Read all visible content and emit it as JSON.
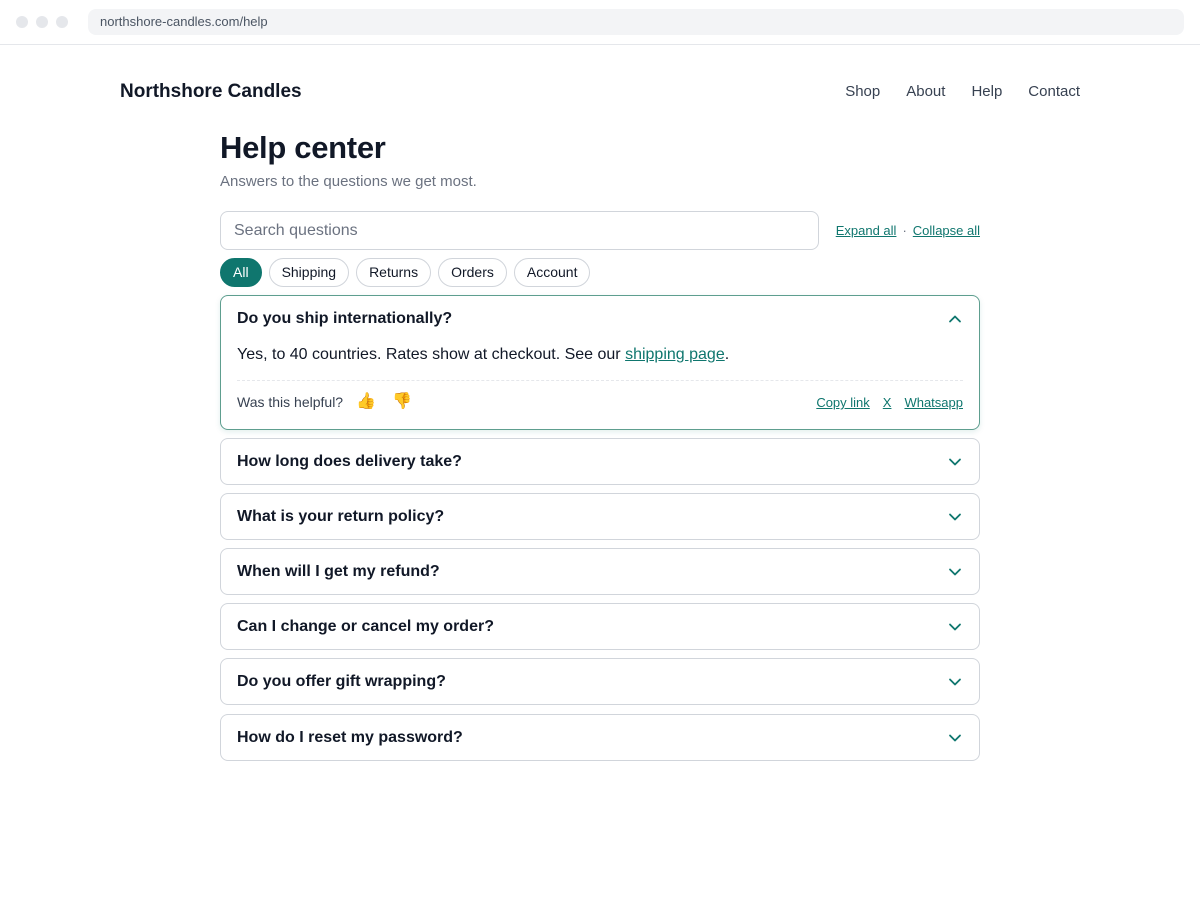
{
  "browser": {
    "url": "northshore-candles.com/help"
  },
  "header": {
    "brand": "Northshore Candles",
    "nav": [
      "Shop",
      "About",
      "Help",
      "Contact"
    ]
  },
  "page": {
    "title": "Help center",
    "subtitle": "Answers to the questions we get most."
  },
  "search": {
    "placeholder": "Search questions",
    "value": ""
  },
  "bulk_actions": {
    "expand_all": "Expand all",
    "separator": "·",
    "collapse_all": "Collapse all"
  },
  "filters": {
    "selected": "All",
    "items": [
      "All",
      "Shipping",
      "Returns",
      "Orders",
      "Account"
    ]
  },
  "faq": {
    "open_item": {
      "question": "Do you ship internationally?",
      "answer_prefix": "Yes, to 40 countries. Rates show at checkout. See our ",
      "answer_link": "shipping page",
      "answer_suffix": ".",
      "helpful_label": "Was this helpful?",
      "thumbs_up": "👍",
      "thumbs_down": "👎",
      "share": [
        "Copy link",
        "X",
        "Whatsapp"
      ]
    },
    "collapsed_items": [
      "How long does delivery take?",
      "What is your return policy?",
      "When will I get my refund?",
      "Can I change or cancel my order?",
      "Do you offer gift wrapping?",
      "How do I reset my password?"
    ]
  },
  "icons": {
    "expanded": "chevron-up-icon",
    "collapsed": "chevron-down-icon"
  },
  "colors": {
    "accent": "#0f766e",
    "text": "#111827",
    "muted": "#6b7280",
    "border": "#d1d5db"
  }
}
